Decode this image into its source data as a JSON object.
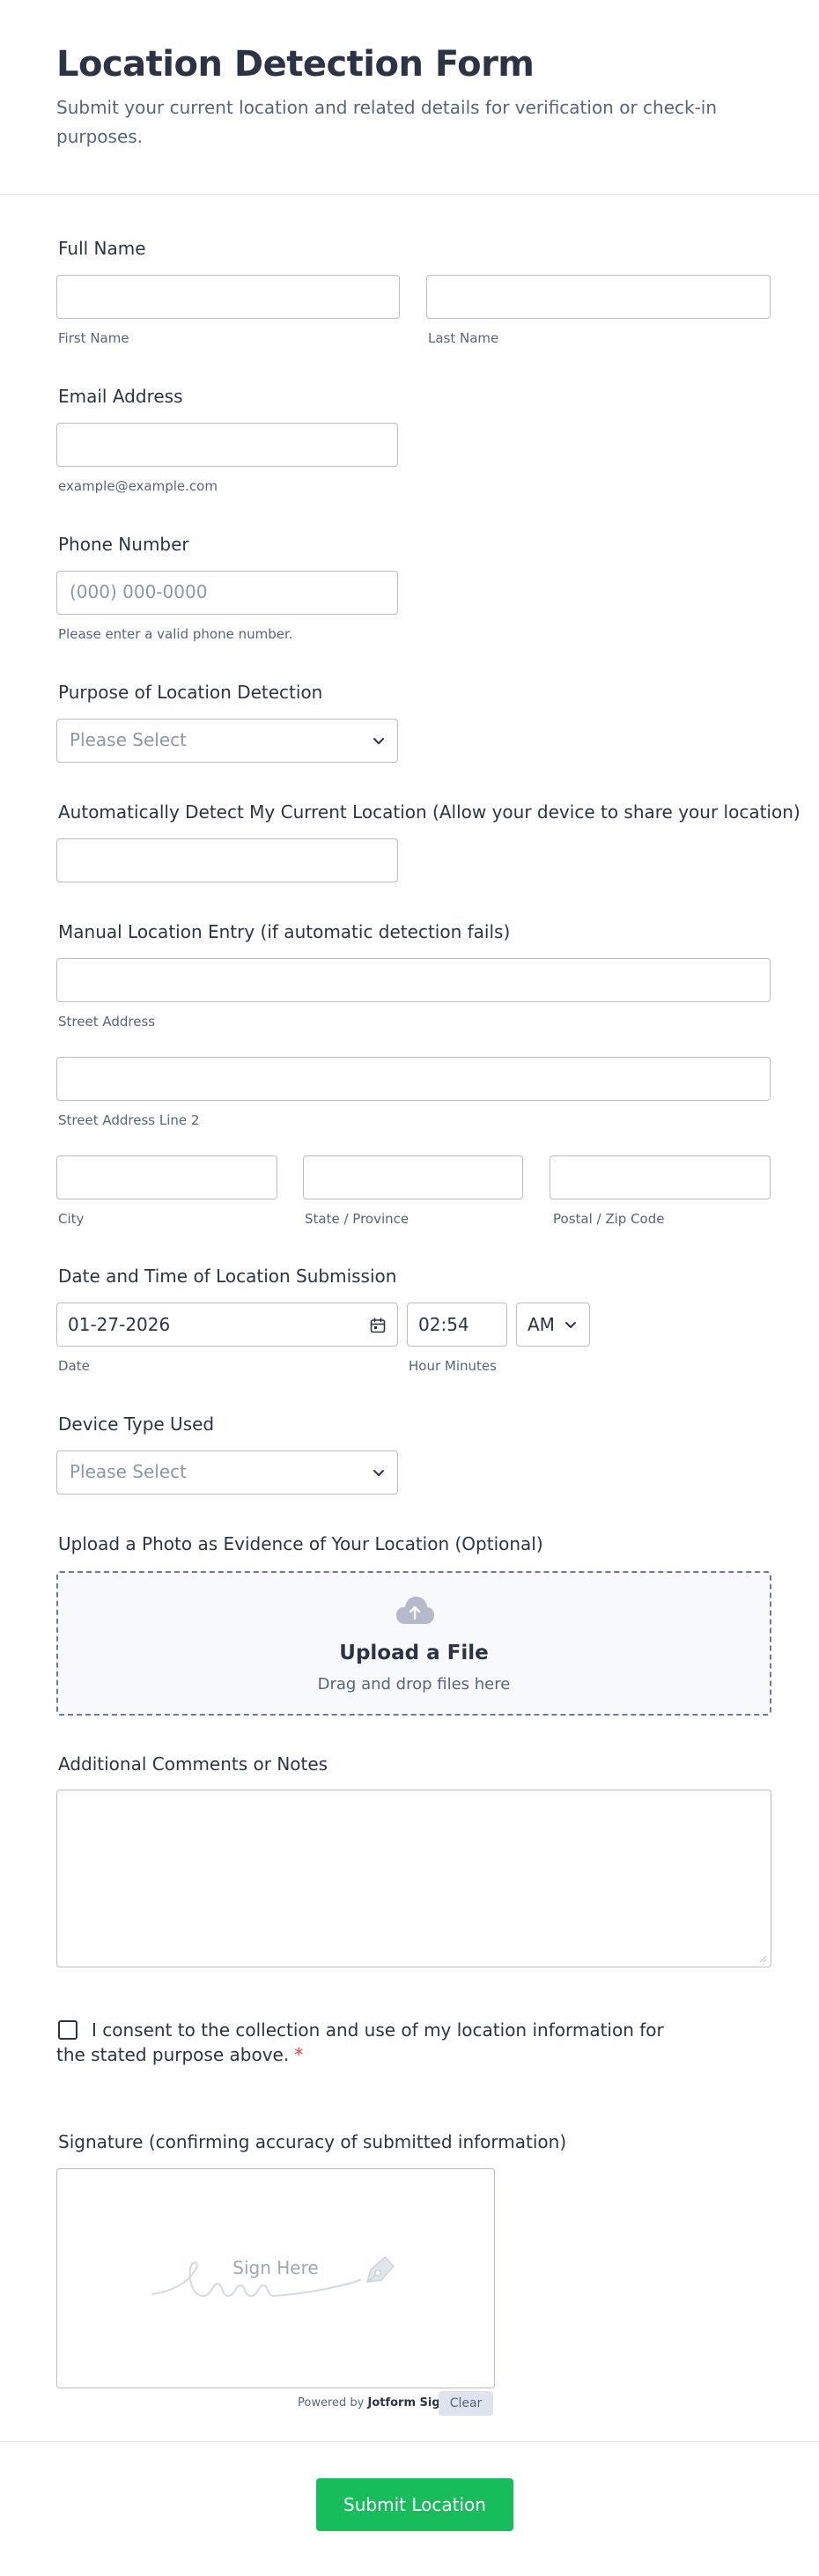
{
  "header": {
    "title": "Location Detection Form",
    "subtitle": "Submit your current location and related details for verification or check-in purposes."
  },
  "full_name": {
    "label": "Full Name",
    "first_sub": "First Name",
    "last_sub": "Last Name"
  },
  "email": {
    "label": "Email Address",
    "sub": "example@example.com"
  },
  "phone": {
    "label": "Phone Number",
    "placeholder": "(000) 000-0000",
    "sub": "Please enter a valid phone number."
  },
  "purpose": {
    "label": "Purpose of Location Detection",
    "placeholder": "Please Select"
  },
  "auto_detect": {
    "label": "Automatically Detect My Current Location (Allow your device to share your location)"
  },
  "manual": {
    "label": "Manual Location Entry (if automatic detection fails)",
    "street_sub": "Street Address",
    "street2_sub": "Street Address Line 2",
    "city_sub": "City",
    "state_sub": "State / Province",
    "postal_sub": "Postal / Zip Code"
  },
  "datetime": {
    "label": "Date and Time of Location Submission",
    "date_value": "01-27-2026",
    "time_value": "02:54",
    "ampm_value": "AM",
    "date_sub": "Date",
    "time_sub": "Hour Minutes"
  },
  "device": {
    "label": "Device Type Used",
    "placeholder": "Please Select"
  },
  "upload": {
    "label": "Upload a Photo as Evidence of Your Location (Optional)",
    "title": "Upload a File",
    "sub": "Drag and drop files here"
  },
  "comments": {
    "label": "Additional Comments or Notes"
  },
  "consent": {
    "text": "I consent to the collection and use of my location information for the stated purpose above.",
    "required_mark": "*"
  },
  "signature": {
    "label": "Signature (confirming accuracy of submitted information)",
    "hint": "Sign Here",
    "powered_prefix": "Powered by ",
    "powered_brand": "Jotform Sign",
    "clear_label": "Clear"
  },
  "submit": {
    "label": "Submit Location"
  },
  "colors": {
    "accent": "#18bd5b",
    "required": "#f23a3c",
    "text": "#2c3345",
    "muted": "#57647e",
    "border": "#b8bdc9"
  },
  "icons": {
    "select": "chevron-down-icon",
    "date": "calendar-icon",
    "upload": "cloud-upload-icon",
    "signature": "pen-icon"
  }
}
